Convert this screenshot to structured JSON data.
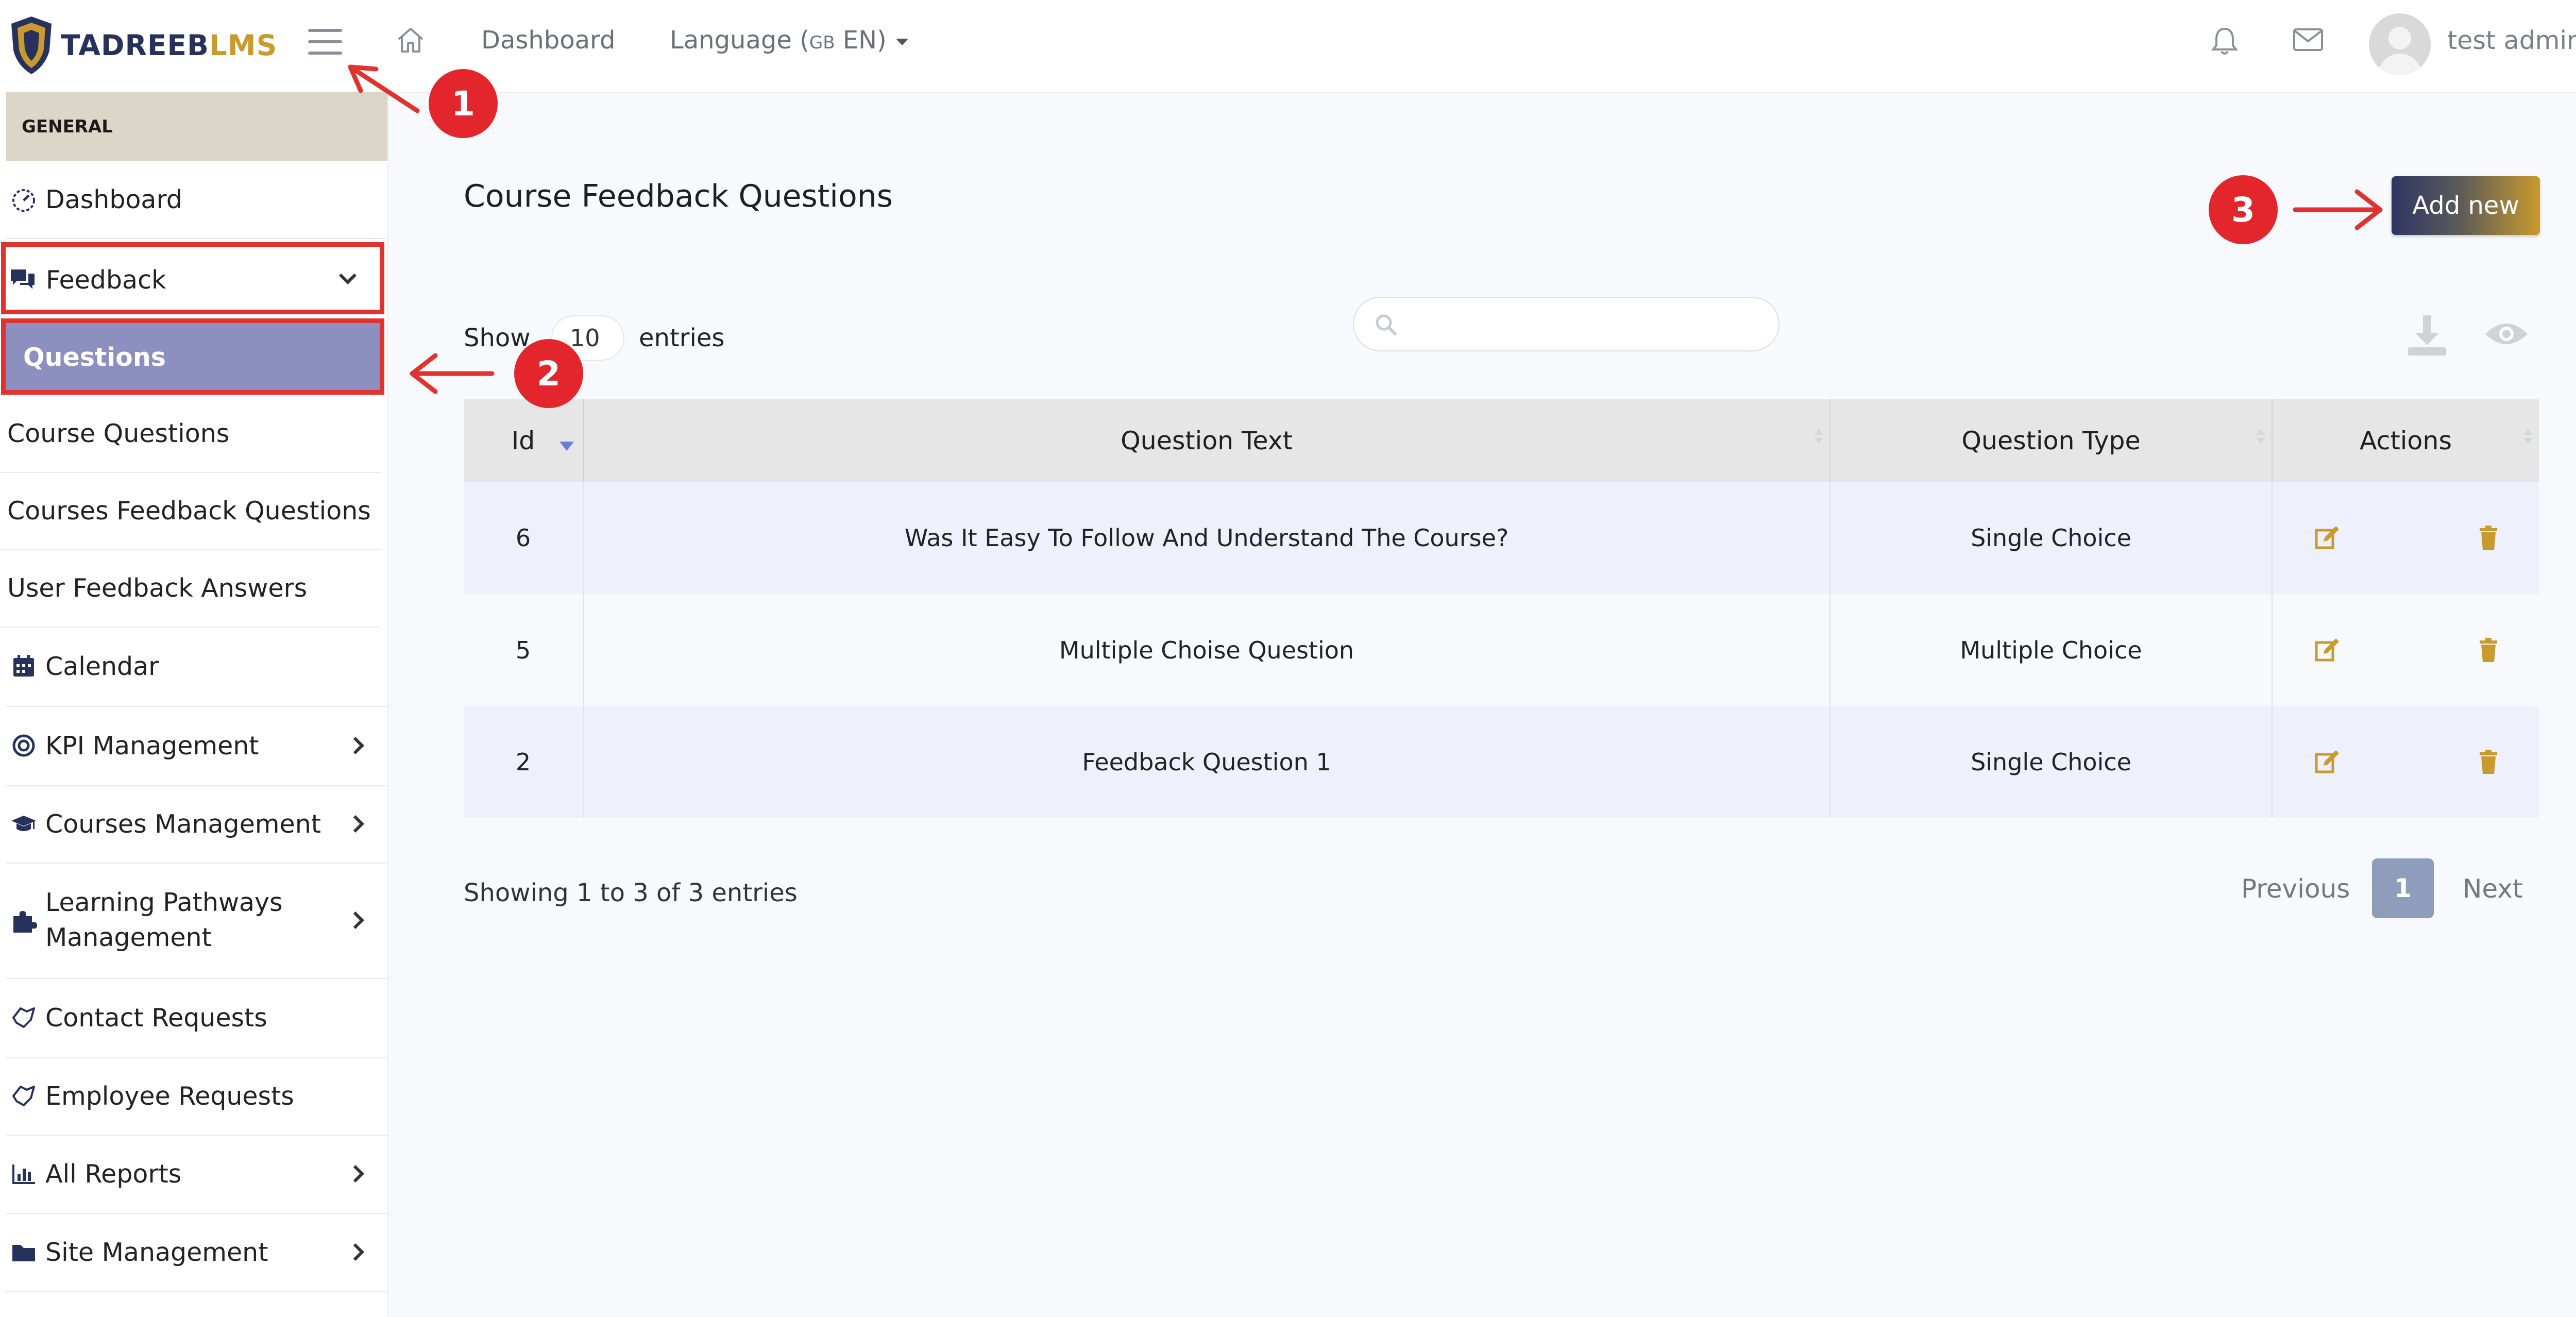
{
  "topbar": {
    "logo_part1": "TADREEB",
    "logo_part2": "LMS",
    "dashboard_link": "Dashboard",
    "language_label": "Language (",
    "language_flag": "GB",
    "language_code": " EN)",
    "user_name": "test admin"
  },
  "sidebar": {
    "section_header": "GENERAL",
    "items": [
      {
        "label": "Dashboard",
        "icon": "dashboard-gauge-icon"
      },
      {
        "label": "Feedback",
        "icon": "comments-icon"
      },
      {
        "label": "Questions"
      },
      {
        "label": "Course Questions"
      },
      {
        "label": "Courses Feedback Questions"
      },
      {
        "label": "User Feedback Answers"
      },
      {
        "label": "Calendar",
        "icon": "calendar-icon"
      },
      {
        "label": "KPI Management",
        "icon": "target-icon"
      },
      {
        "label": "Courses Management",
        "icon": "graduation-cap-icon"
      },
      {
        "label": "Learning Pathways",
        "label2": "Management",
        "icon": "puzzle-icon"
      },
      {
        "label": "Contact Requests",
        "icon": "handshake-icon"
      },
      {
        "label": "Employee Requests",
        "icon": "handshake-icon"
      },
      {
        "label": "All Reports",
        "icon": "bar-chart-icon"
      },
      {
        "label": "Site Management",
        "icon": "folder-icon"
      }
    ]
  },
  "main": {
    "title": "Course Feedback Questions",
    "add_button": "Add new",
    "show_label": "Show",
    "entries_value": "10",
    "entries_label": "entries",
    "search_placeholder": "",
    "table": {
      "headers": [
        "Id",
        "Question Text",
        "Question Type",
        "Actions"
      ],
      "rows": [
        {
          "id": "6",
          "text": "Was It Easy To Follow And Understand The Course?",
          "type": "Single Choice"
        },
        {
          "id": "5",
          "text": "Multiple Choise Question",
          "type": "Multiple Choice"
        },
        {
          "id": "2",
          "text": "Feedback Question 1",
          "type": "Single Choice"
        }
      ]
    },
    "showing_text": "Showing 1 to 3 of 3 entries",
    "pagination": {
      "previous": "Previous",
      "current": "1",
      "next": "Next"
    }
  },
  "annotations": {
    "step1": "1",
    "step2": "2",
    "step3": "3"
  },
  "colors": {
    "accent_gold": "#c99a2e",
    "brand_navy": "#26325c",
    "annotation_red": "#e0322f",
    "selected_item": "#8c8fbf"
  }
}
